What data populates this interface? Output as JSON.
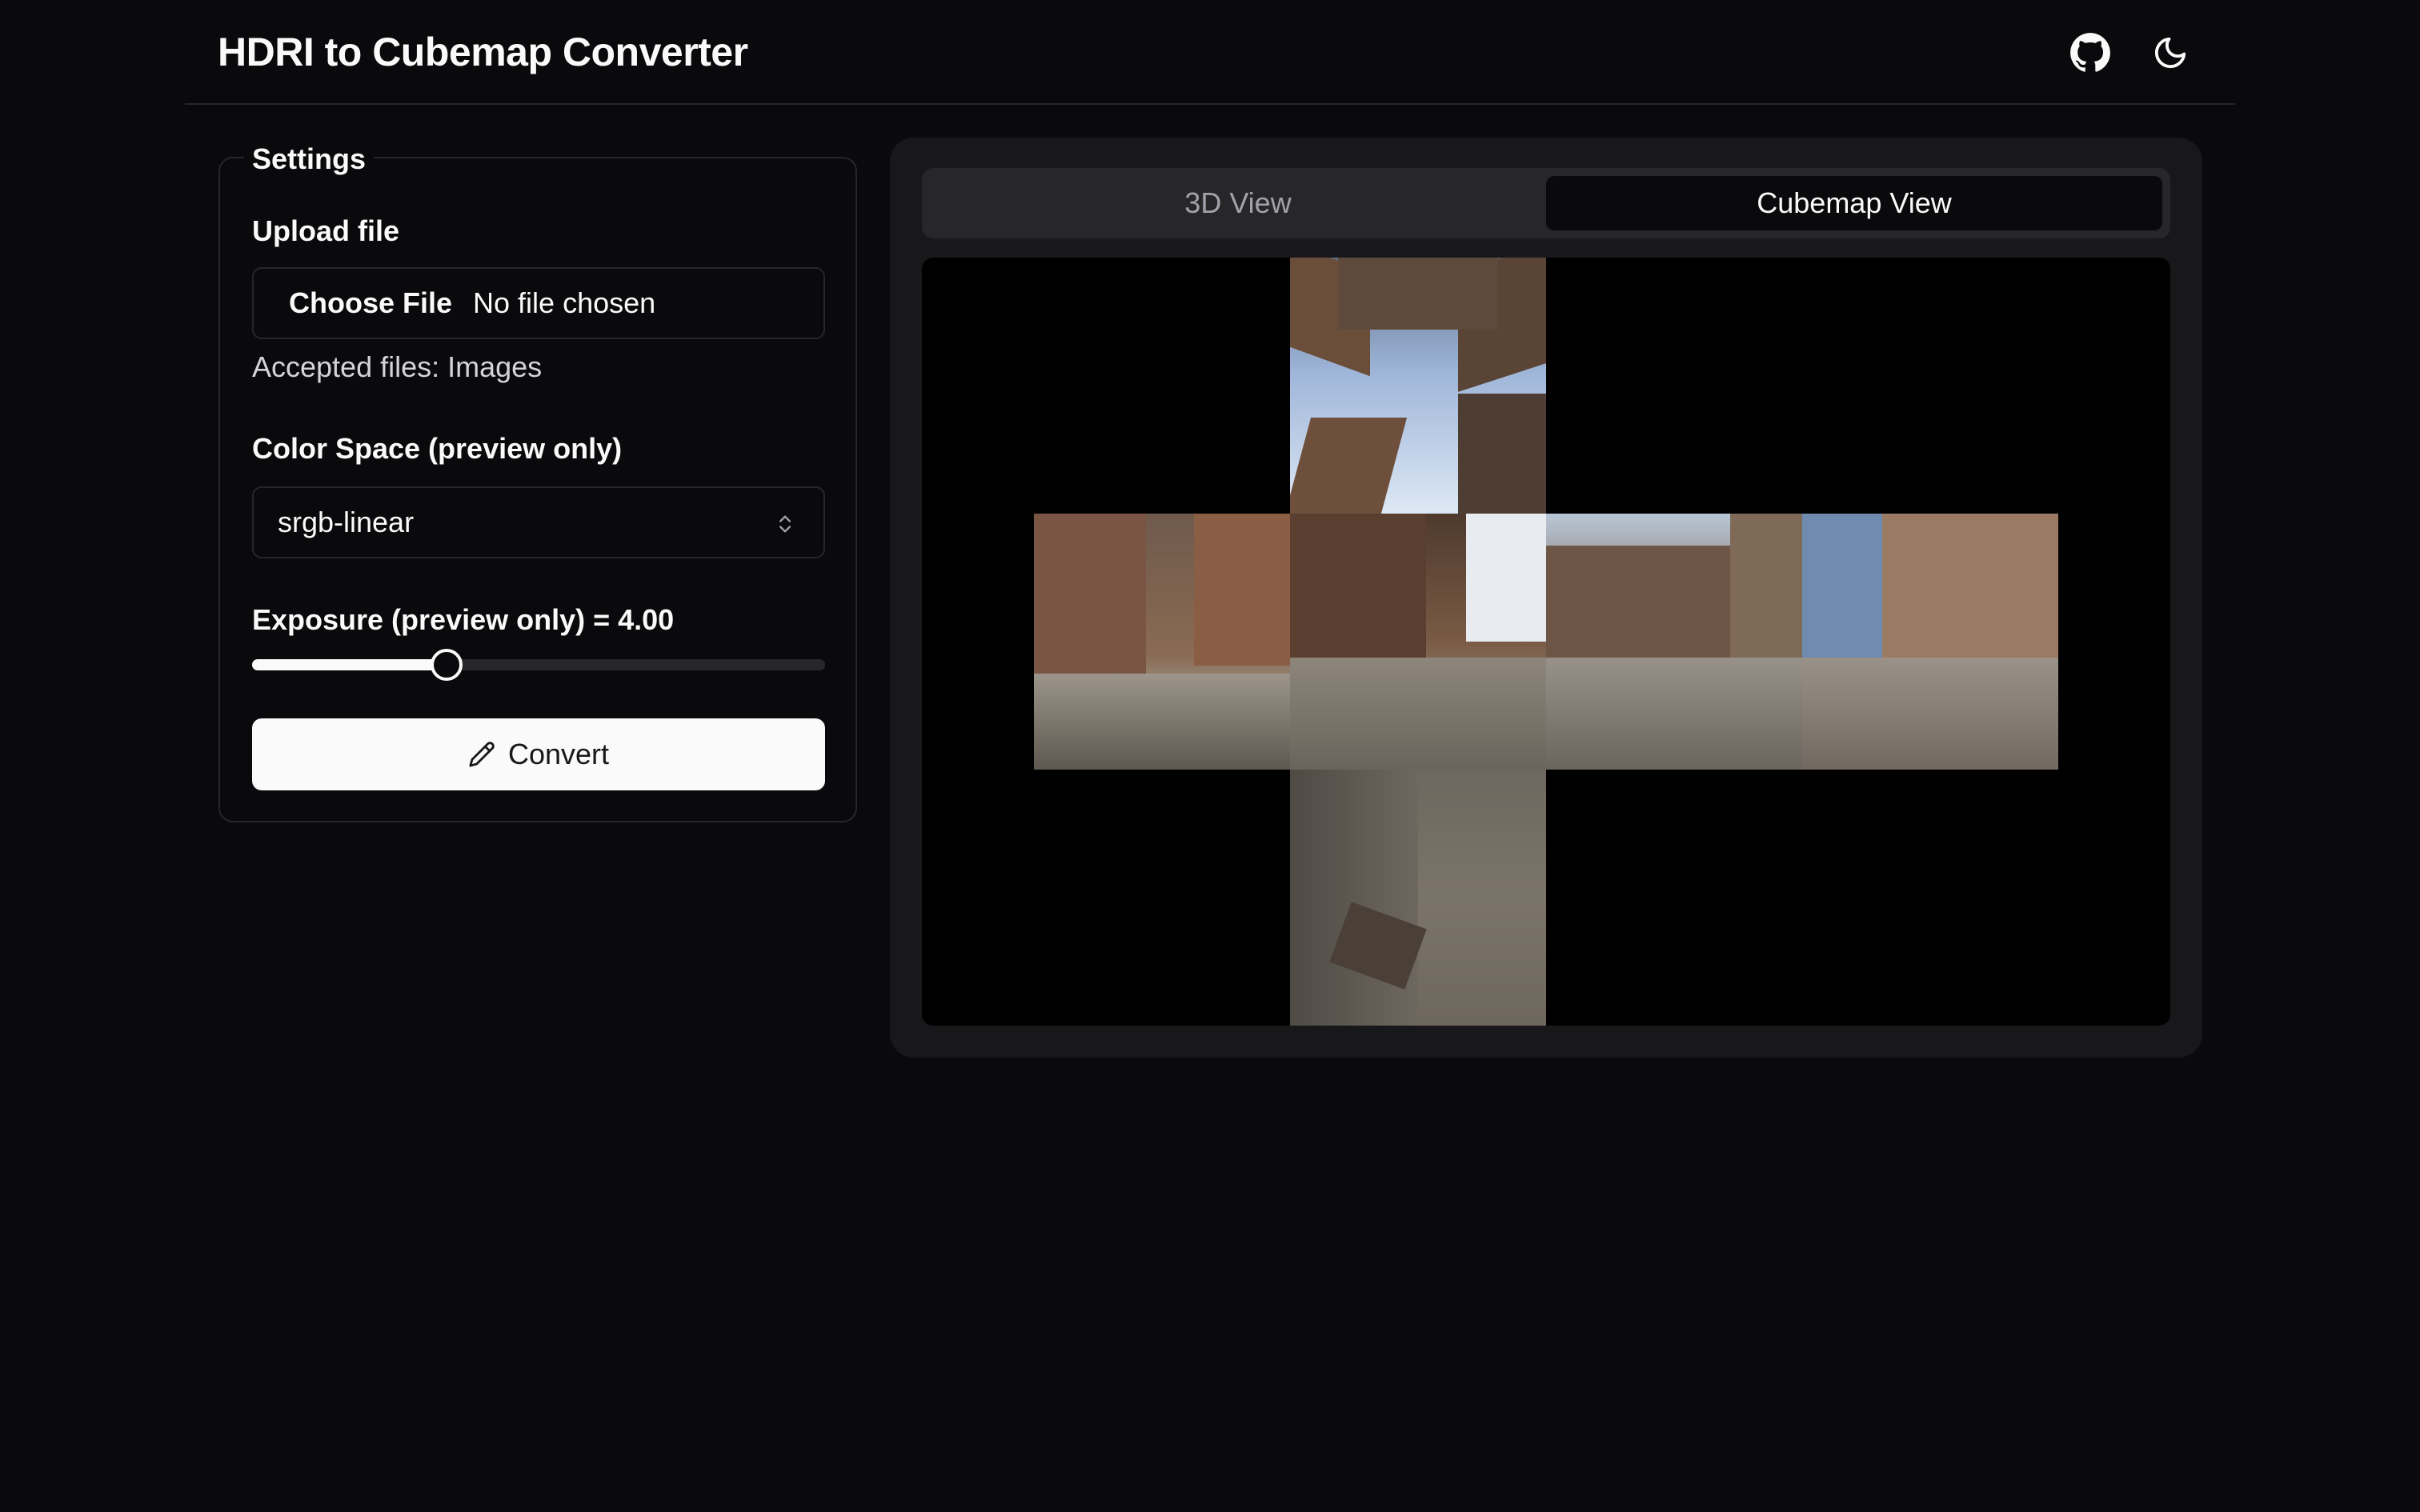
{
  "header": {
    "title": "HDRI to Cubemap Converter",
    "icons": [
      "github-icon",
      "moon-icon"
    ]
  },
  "settings": {
    "legend": "Settings",
    "upload": {
      "label": "Upload file",
      "button_label": "Choose File",
      "status": "No file chosen",
      "hint": "Accepted files: Images"
    },
    "color_space": {
      "label": "Color Space (preview only)",
      "selected": "srgb-linear"
    },
    "exposure": {
      "label": "Exposure (preview only) = 4.00",
      "slider_fraction": 0.34
    },
    "convert_label": "Convert"
  },
  "preview": {
    "tabs": [
      {
        "label": "3D View",
        "active": false
      },
      {
        "label": "Cubemap View",
        "active": true
      }
    ]
  },
  "colors": {
    "background": "#0a0a0c",
    "panel": "#18181b",
    "border": "#27272a",
    "primary_button": "#fafafa"
  }
}
